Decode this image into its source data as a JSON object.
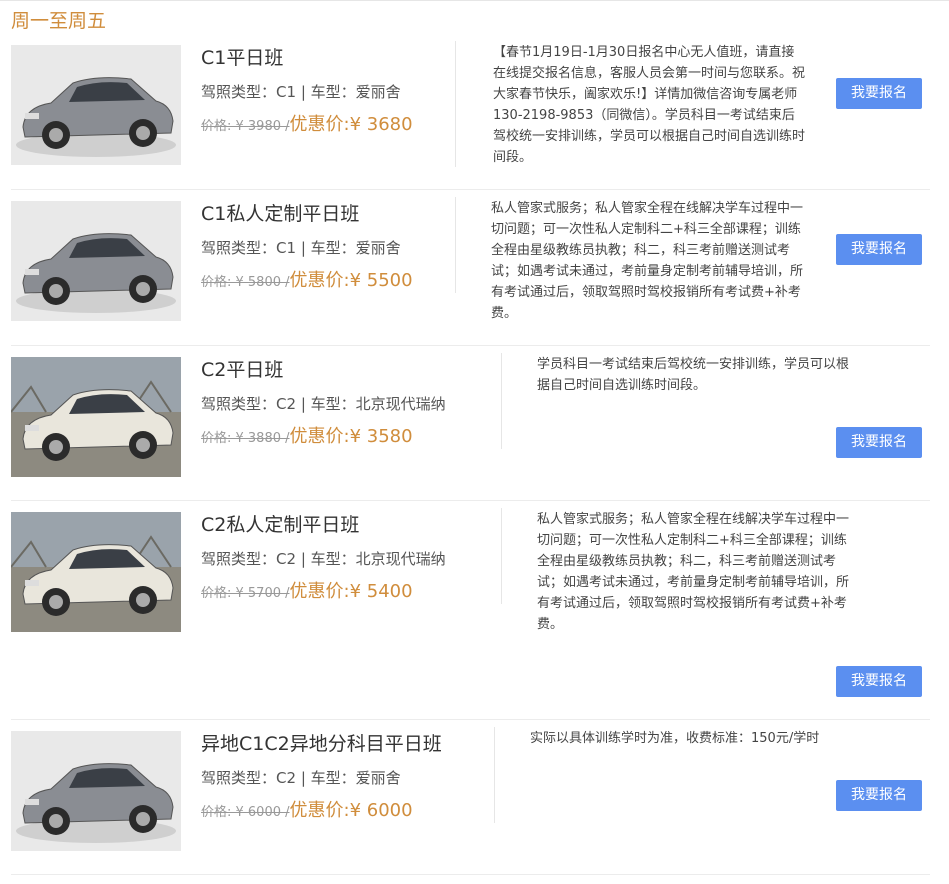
{
  "section_title": "周一至周五",
  "items": [
    {
      "name": "C1平日班",
      "license_label": "驾照类型：",
      "license": "C1",
      "car_label": "车型：",
      "car": "爱丽舍",
      "orig_price": "价格: ¥ 3980 /",
      "sale_label": "优惠价:",
      "sale_price": "¥ 3680",
      "description": "【春节1月19日-1月30日报名中心无人值班，请直接在线提交报名信息，客服人员会第一时间与您联系。祝大家春节快乐，阖家欢乐!】详情加微信咨询专属老师130-2198-9853（同微信）。学员科目一考试结束后驾校统一安排训练，学员可以根据自己时间自选训练时间段。",
      "button": "我要报名",
      "car_color": "#8a8d93"
    },
    {
      "name": "C1私人定制平日班",
      "license_label": "驾照类型：",
      "license": "C1",
      "car_label": "车型：",
      "car": "爱丽舍",
      "orig_price": "价格: ¥ 5800 /",
      "sale_label": "优惠价:",
      "sale_price": "¥ 5500",
      "description": "私人管家式服务；私人管家全程在线解决学车过程中一切问题；可一次性私人定制科二+科三全部课程；训练全程由星级教练员执教；科二，科三考前赠送测试考试；如遇考试未通过，考前量身定制考前辅导培训，所有考试通过后，领取驾照时驾校报销所有考试费+补考费。",
      "button": "我要报名",
      "car_color": "#8a8d93"
    },
    {
      "name": "C2平日班",
      "license_label": "驾照类型：",
      "license": "C2",
      "car_label": "车型：",
      "car": "北京现代瑞纳",
      "orig_price": "价格: ¥ 3880 /",
      "sale_label": "优惠价:",
      "sale_price": "¥ 3580",
      "description": "学员科目一考试结束后驾校统一安排训练，学员可以根据自己时间自选训练时间段。",
      "button": "我要报名",
      "car_color": "#e9e6dc"
    },
    {
      "name": "C2私人定制平日班",
      "license_label": "驾照类型：",
      "license": "C2",
      "car_label": "车型：",
      "car": "北京现代瑞纳",
      "orig_price": "价格: ¥ 5700 /",
      "sale_label": "优惠价:",
      "sale_price": "¥ 5400",
      "description": "私人管家式服务；私人管家全程在线解决学车过程中一切问题；可一次性私人定制科二+科三全部课程；训练全程由星级教练员执教；科二，科三考前赠送测试考试；如遇考试未通过，考前量身定制考前辅导培训，所有考试通过后，领取驾照时驾校报销所有考试费+补考费。",
      "button": "我要报名",
      "car_color": "#e9e6dc"
    },
    {
      "name": "异地C1C2异地分科目平日班",
      "license_label": "驾照类型：",
      "license": "C2",
      "car_label": "车型：",
      "car": "爱丽舍",
      "orig_price": "价格: ¥ 6000 /",
      "sale_label": "优惠价:",
      "sale_price": "¥ 6000",
      "description": "实际以具体训练学时为准，收费标准：150元/学时",
      "button": "我要报名",
      "car_color": "#8a8d93"
    }
  ]
}
